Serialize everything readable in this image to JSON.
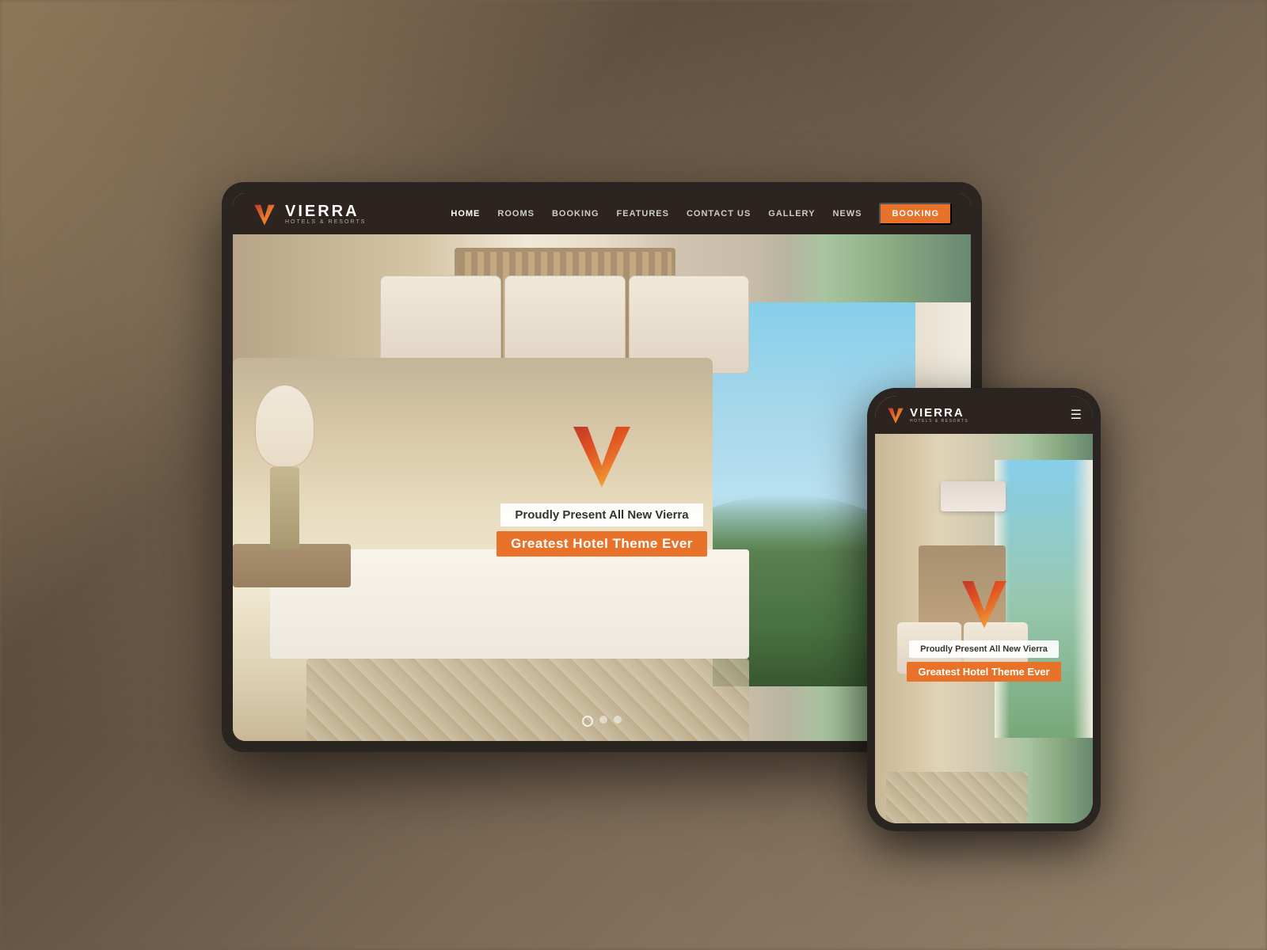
{
  "page": {
    "title": "Vierra Hotels & Resorts - Greatest Hotel Theme Ever"
  },
  "background": {
    "overlay_color": "#6b5c4e"
  },
  "tablet": {
    "navbar": {
      "logo_name": "VIERRA",
      "logo_sub": "HOTELS & RESORTS",
      "nav_items": [
        {
          "label": "HOME",
          "active": true
        },
        {
          "label": "ROOMS",
          "active": false
        },
        {
          "label": "BOOKING",
          "active": false
        },
        {
          "label": "FEATURES",
          "active": false
        },
        {
          "label": "CONTACT US",
          "active": false
        },
        {
          "label": "GALLERY",
          "active": false
        },
        {
          "label": "NEWS",
          "active": false
        }
      ],
      "booking_button": "BOOKING"
    },
    "hero": {
      "subtitle": "Proudly Present All New Vierra",
      "title": "Greatest Hotel Theme Ever"
    },
    "slider": {
      "dots": 3,
      "active_dot": 0
    }
  },
  "mobile": {
    "navbar": {
      "logo_name": "VIERRA",
      "logo_sub": "HOTELS & RESORTS",
      "hamburger_icon": "☰"
    },
    "hero": {
      "subtitle": "Proudly Present All New Vierra",
      "title": "Greatest Hotel Theme Ever"
    }
  }
}
